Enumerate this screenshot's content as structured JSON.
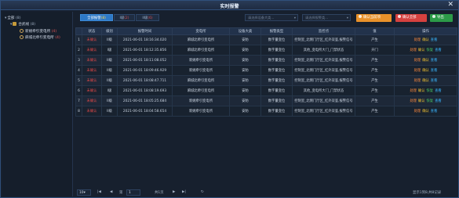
{
  "window": {
    "title": "实时报警",
    "close_icon": "close-icon"
  },
  "tree": {
    "root": {
      "label": "全部",
      "count": "(8)"
    },
    "group": {
      "label": "合武线",
      "count": "(8)"
    },
    "stations": [
      {
        "label": "新姚牵引变电所",
        "count": "(4)"
      },
      {
        "label": "麻城北牵引变电所",
        "count": "(4)"
      }
    ]
  },
  "toolbar": {
    "tabs": [
      {
        "label": "全部报警",
        "count": "(8)"
      },
      {
        "label": "I级",
        "count": "(2)"
      },
      {
        "label": "II级",
        "count": "(6)"
      }
    ],
    "device_type_placeholder": "请选择设备大类...",
    "alarm_type_placeholder": "请选择报警类...",
    "handle_label": "确认当前项",
    "confirm_all_label": "确认全部",
    "export_label": "导出",
    "colors": {
      "accent": "#2d79c7",
      "handle": "#e8912a",
      "confirm_all": "#d6413f",
      "export": "#2c9b48"
    }
  },
  "table": {
    "columns": [
      "",
      "状态",
      "级别",
      "报警时间",
      "变电所",
      "设备大类",
      "报警类型",
      "监控点",
      "值",
      "操作"
    ],
    "rows": [
      {
        "idx": "1",
        "status": "未确认",
        "level": "II级",
        "time": "2021-06-01 18:16:34.020",
        "station": "麻城北牵引变电所",
        "device": "安防",
        "type": "数字量变位",
        "point": "控制室_北侧门厅区_红外双鉴,报警信号",
        "value": "产生",
        "ops": [
          "处理",
          "确认",
          "查看"
        ]
      },
      {
        "idx": "2",
        "status": "未确认",
        "level": "I级",
        "time": "2021-06-01 18:12:35.856",
        "station": "麻城北牵引变电所",
        "device": "安防",
        "type": "数字量变位",
        "point": "其他_变电所大门_门禁状态",
        "value": "开门",
        "ops": [
          "处理",
          "确认",
          "恢复",
          "查看"
        ]
      },
      {
        "idx": "3",
        "status": "未确认",
        "level": "II级",
        "time": "2021-06-01 18:11:08.052",
        "station": "新姚牵引变电所",
        "device": "安防",
        "type": "数字量变位",
        "point": "控制室_北侧门厅区_红外双鉴,报警信号",
        "value": "产生",
        "ops": [
          "处理",
          "确认",
          "查看"
        ]
      },
      {
        "idx": "4",
        "status": "未确认",
        "level": "II级",
        "time": "2021-06-01 18:09:46.929",
        "station": "新姚牵引变电所",
        "device": "安防",
        "type": "数字量变位",
        "point": "控制室_北侧门厅区_红外双鉴,报警信号",
        "value": "产生",
        "ops": [
          "处理",
          "确认",
          "查看"
        ]
      },
      {
        "idx": "5",
        "status": "未确认",
        "level": "II级",
        "time": "2021-06-01 18:08:47.711",
        "station": "麻城北牵引变电所",
        "device": "安防",
        "type": "数字量变位",
        "point": "控制室_北侧门厅区_红外双鉴,报警信号",
        "value": "产生",
        "ops": [
          "处理",
          "确认",
          "查看"
        ]
      },
      {
        "idx": "6",
        "status": "未确认",
        "level": "I级",
        "time": "2021-06-01 18:08:19.693",
        "station": "麻城北牵引变电所",
        "device": "安防",
        "type": "数字量变位",
        "point": "其他_变电所大门_门禁状态",
        "value": "产生",
        "ops": [
          "处理",
          "确认",
          "恢复",
          "查看"
        ]
      },
      {
        "idx": "7",
        "status": "未确认",
        "level": "II级",
        "time": "2021-06-01 18:05:25.684",
        "station": "新姚牵引变电所",
        "device": "安防",
        "type": "数字量变位",
        "point": "控制室_北侧门厅区_红外双鉴,报警信号",
        "value": "产生",
        "ops": [
          "处理",
          "确认",
          "恢复",
          "查看"
        ]
      },
      {
        "idx": "8",
        "status": "未确认",
        "level": "II级",
        "time": "2021-06-01 18:04:58.654",
        "station": "新姚牵引变电所",
        "device": "安防",
        "type": "数字量变位",
        "point": "控制室_北侧门厅区_红外双鉴,报警信号",
        "value": "产生",
        "ops": [
          "处理",
          "确认",
          "查看"
        ]
      }
    ]
  },
  "pager": {
    "page_size": "10",
    "page_prefix": "第",
    "page_value": "1",
    "page_suffix": "共1页",
    "summary": "显示1到8,共8记录"
  }
}
